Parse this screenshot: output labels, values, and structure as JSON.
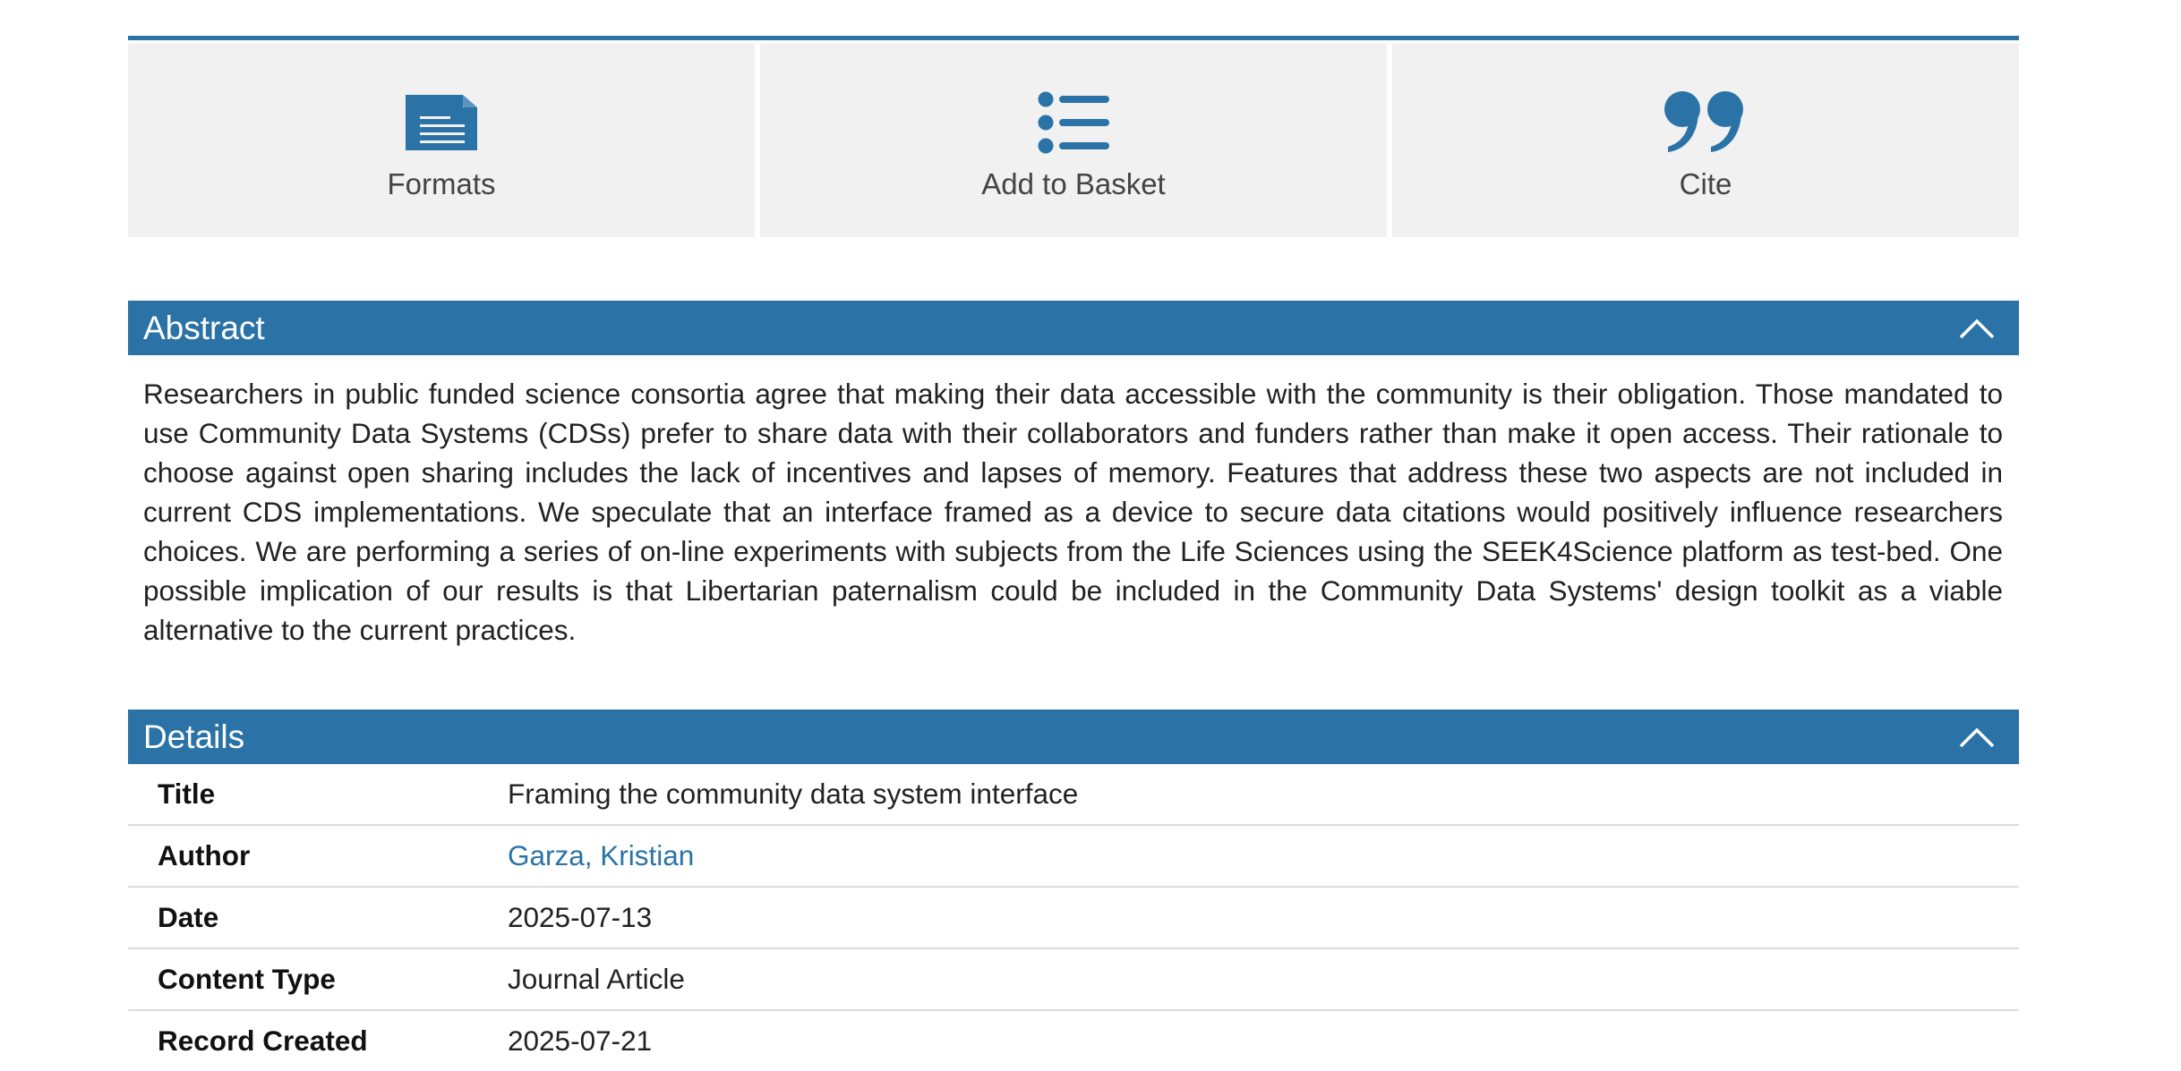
{
  "actions": [
    {
      "label": "Formats",
      "icon": "document-icon"
    },
    {
      "label": "Add to Basket",
      "icon": "list-icon"
    },
    {
      "label": "Cite",
      "icon": "quote-icon"
    }
  ],
  "abstract": {
    "header": "Abstract",
    "text": "Researchers in public funded science consortia agree that making their data accessible with the community is their obligation. Those mandated to use Community Data Systems (CDSs) prefer to share data with their collaborators and funders rather than make it open access. Their rationale to choose against open sharing includes the lack of incentives and lapses of memory. Features that address these two aspects are not included in current CDS implementations. We speculate that an interface framed as a device to secure data citations would positively influence researchers choices. We are performing a series of on-line experiments with subjects from the Life Sciences using the SEEK4Science platform as test-bed. One possible implication of our results is that Libertarian paternalism could be included in the Community Data Systems' design toolkit as a viable alternative to the current practices."
  },
  "details": {
    "header": "Details",
    "rows": [
      {
        "key": "Title",
        "value": "Framing the community data system interface"
      },
      {
        "key": "Author",
        "value": "Garza, Kristian"
      },
      {
        "key": "Date",
        "value": "2025-07-13"
      },
      {
        "key": "Content Type",
        "value": "Journal Article"
      },
      {
        "key": "Record Created",
        "value": "2025-07-21"
      }
    ]
  },
  "colors": {
    "accent": "#2b73a6",
    "panel": "#f1f1f2"
  }
}
